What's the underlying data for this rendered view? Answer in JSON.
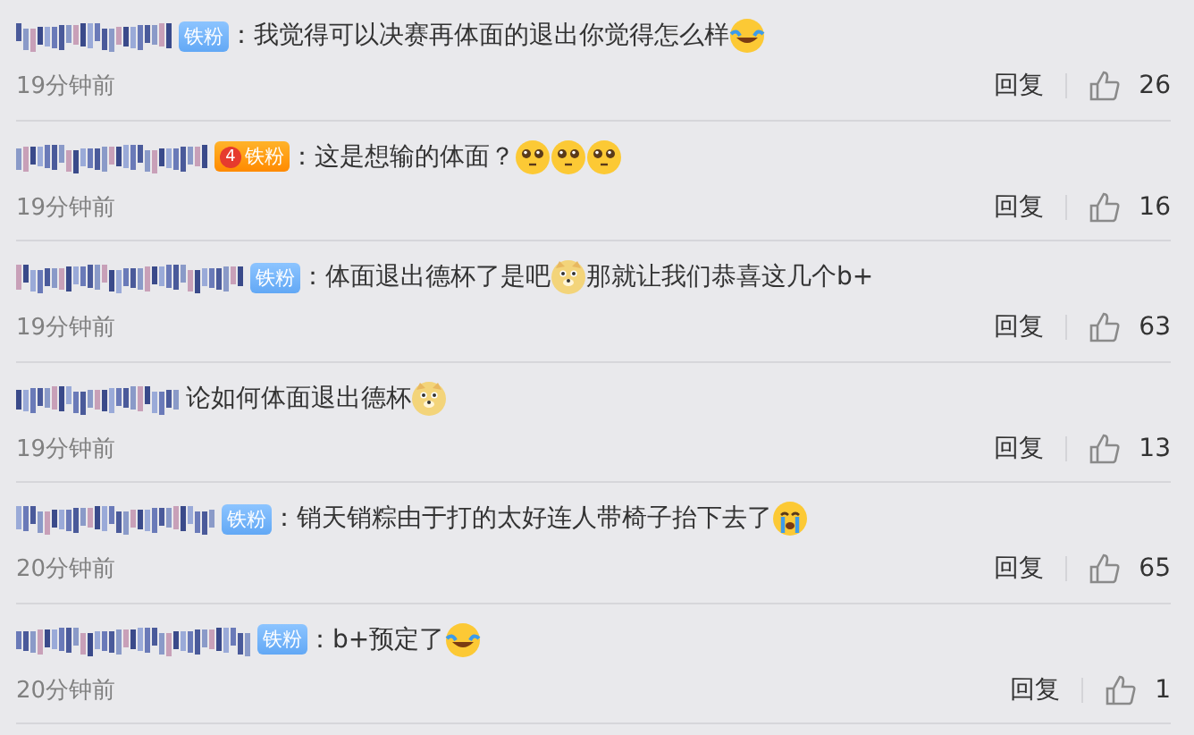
{
  "comments": [
    {
      "badge": {
        "kind": "blue",
        "label": "铁粉"
      },
      "content": [
        {
          "kind": "text",
          "text": "：我觉得可以决赛再体面的退出你觉得怎么样"
        },
        {
          "kind": "laughing"
        }
      ],
      "time": "19分钟前",
      "reply": "回复",
      "likes": "26"
    },
    {
      "badge": {
        "kind": "crown",
        "label": "铁粉",
        "level_text": "4"
      },
      "content": [
        {
          "kind": "text",
          "text": "：这是想输的体面？"
        },
        {
          "kind": "pleading"
        },
        {
          "kind": "pleading"
        },
        {
          "kind": "pleading"
        }
      ],
      "time": "19分钟前",
      "reply": "回复",
      "likes": "16"
    },
    {
      "badge": {
        "kind": "blue",
        "label": "铁粉"
      },
      "content": [
        {
          "kind": "text",
          "text": "：体面退出德杯了是吧"
        },
        {
          "kind": "doge"
        },
        {
          "kind": "text",
          "text": "那就让我们恭喜这几个b+"
        }
      ],
      "time": "19分钟前",
      "reply": "回复",
      "likes": "63"
    },
    {
      "content": [
        {
          "kind": "text",
          "text": "论如何体面退出德杯"
        },
        {
          "kind": "doge"
        }
      ],
      "time": "19分钟前",
      "reply": "回复",
      "likes": "13"
    },
    {
      "badge": {
        "kind": "blue",
        "label": "铁粉"
      },
      "content": [
        {
          "kind": "text",
          "text": "：销天销粽由于打的太好连人带椅子抬下去了"
        },
        {
          "kind": "crying"
        }
      ],
      "time": "20分钟前",
      "reply": "回复",
      "likes": "65"
    },
    {
      "badge": {
        "kind": "blue",
        "label": "铁粉"
      },
      "content": [
        {
          "kind": "text",
          "text": "：b+预定了"
        },
        {
          "kind": "laughing"
        }
      ],
      "time": "20分钟前",
      "reply": "回复",
      "likes": "1"
    }
  ]
}
